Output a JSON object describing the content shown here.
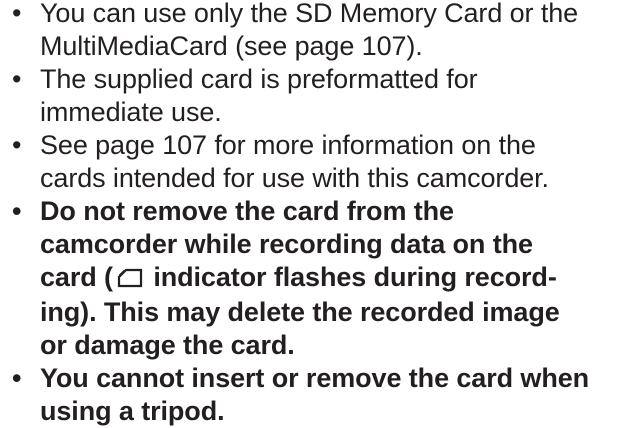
{
  "bullet_char": "•",
  "items": [
    {
      "lines": [
        "You can use only the SD Memory Card or the",
        "MultiMediaCard (see page 107)."
      ]
    },
    {
      "lines": [
        "The supplied card is preformatted for",
        "immediate use."
      ]
    },
    {
      "lines": [
        "See page 107 for more information on the",
        "cards intended for use with this camcorder."
      ]
    },
    {
      "line1": "Do not remove the card from the",
      "line2": "camcorder while recording data on the",
      "line3_before_icon": "card (",
      "card_icon": "card-indicator-icon",
      "line3_after_icon": " indicator flashes during record-",
      "line4": "ing). This may delete the recorded image",
      "line5": "or damage the card."
    },
    {
      "lines": [
        "You cannot insert or remove the card when",
        "using a tripod."
      ]
    }
  ]
}
